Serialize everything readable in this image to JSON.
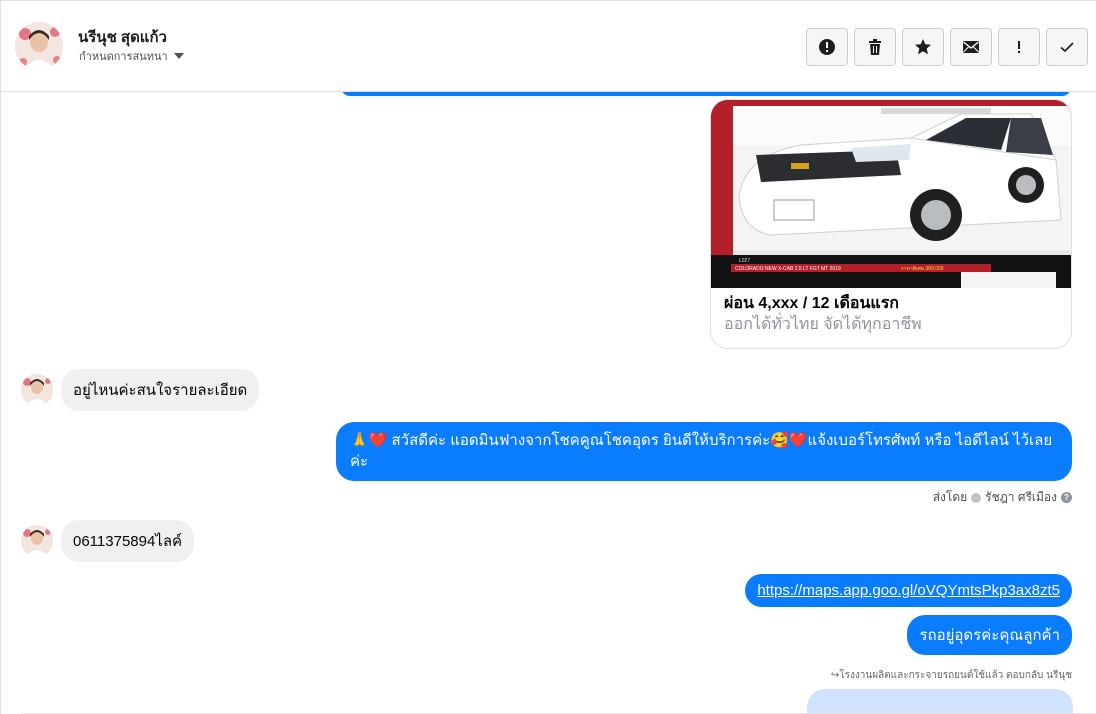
{
  "header": {
    "contact_name": "นรีนุช สุดแก้ว",
    "assign_label": "กำหนดการสนทนา",
    "actions": [
      {
        "name": "report-spam-button",
        "icon": "alert-icon"
      },
      {
        "name": "delete-button",
        "icon": "trash-icon"
      },
      {
        "name": "star-button",
        "icon": "star-icon"
      },
      {
        "name": "mark-unread-button",
        "icon": "envelope-icon"
      },
      {
        "name": "follow-up-button",
        "icon": "exclamation-icon"
      },
      {
        "name": "mark-done-button",
        "icon": "check-icon"
      }
    ]
  },
  "card": {
    "title": "ผ่อน 4,xxx / 12 เดือนแรก",
    "subtitle": "ออกได้ทั่วไทย จัดได้ทุกอาชีพ",
    "image_caption": "COLORADO NEW X-CAB 2.5 LT FGT MT 2019",
    "image_price": "ราคาพิเศษ 389,000",
    "image_code": "L027"
  },
  "messages": {
    "incoming_1": "อยู่ไหนค่ะสนใจรายละเอียด",
    "outgoing_1": "🙏❤️ สวัสดีค่ะ แอดมินฟางจากโชคคูณโชคอุดร ยินดีให้บริการค่ะ🥰❤️แจ้งเบอร์โทรศัพท์ หรือ ไอดีไลน์  ไว้เลยค่ะ",
    "sent_by_label": "ส่งโดย",
    "sent_by_agent": "รัชฎา ศรีเมือง",
    "incoming_2": "0611375894ไลค์",
    "outgoing_link": "https://maps.app.goo.gl/oVQYmtsPkp3ax8zt5",
    "outgoing_2": "รถอยู่อุดรค่ะคุณลูกค้า",
    "reply_note": "โรงงานผลิตและกระจายรถยนต์ใช้แล้ว ตอบกลับ นรีนุช"
  },
  "colors": {
    "outgoing_bubble": "#0a7cff",
    "incoming_bubble": "#f0f0f0",
    "border": "#dddfe2"
  }
}
